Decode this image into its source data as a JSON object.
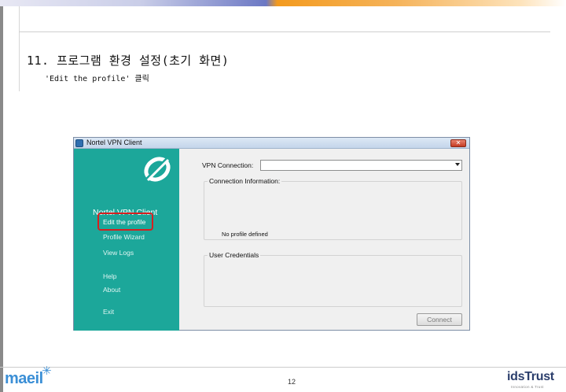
{
  "slide": {
    "title": "11. 프로그램 환경 설정(초기 화면)",
    "subtitle": "'Edit the profile'  클릭",
    "page_number": "12",
    "footer_left_logo": "maeil",
    "footer_right_logo": "idsTrust",
    "footer_right_tagline": "Innovation & Trust"
  },
  "window": {
    "title": "Nortel VPN Client",
    "close_glyph": "✕",
    "sidebar": {
      "brand": "Nortel VPN Client",
      "items": [
        {
          "label": "Edit the profile"
        },
        {
          "label": "Profile Wizard"
        },
        {
          "label": "View Logs"
        },
        {
          "label": "Help"
        },
        {
          "label": "About"
        },
        {
          "label": "Exit"
        }
      ]
    },
    "vpn_connection_label": "VPN Connection:",
    "vpn_connection_value": "",
    "connection_info_legend": "Connection Information:",
    "no_profile_text": "No profile defined",
    "user_credentials_legend": "User Credentials",
    "connect_label": "Connect"
  },
  "colors": {
    "sidebar_teal": "#1ca79a",
    "highlight_red": "#d61f1f",
    "maeil_blue": "#3b8fd6",
    "idstrust_navy": "#2b3e6c"
  },
  "icons": [
    "nortel-app-icon",
    "close-icon",
    "nortel-logo-icon",
    "dropdown-arrow-icon",
    "maeil-star-icon"
  ]
}
